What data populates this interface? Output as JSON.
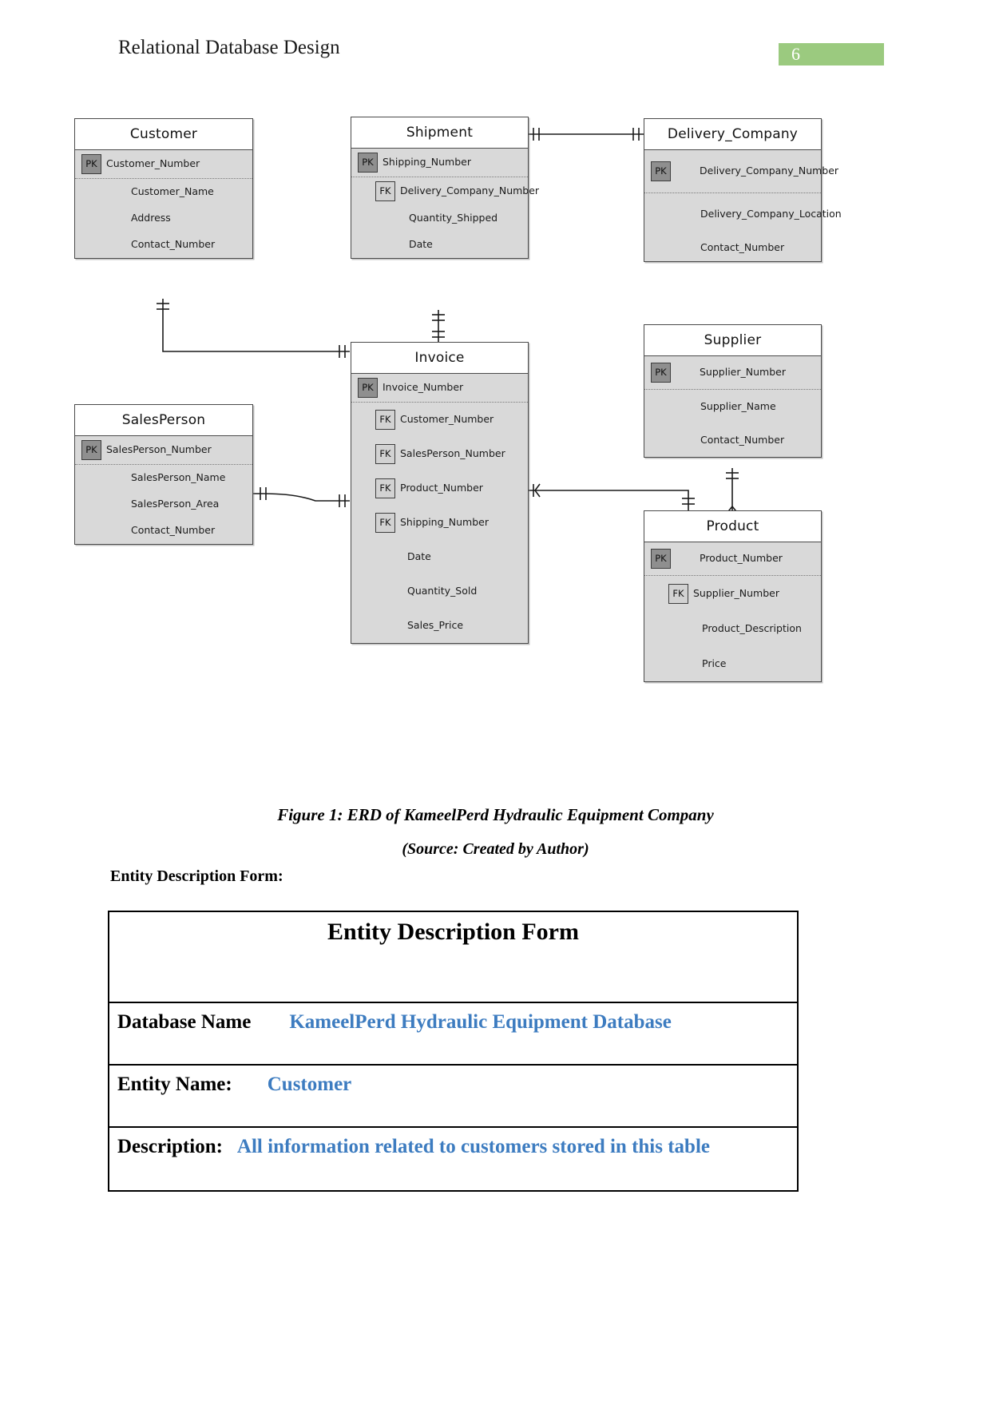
{
  "header": {
    "title": "Relational Database Design",
    "page_number": "6",
    "page_number_bg": "#9bca7f"
  },
  "erd": {
    "entities": [
      {
        "id": "customer",
        "name": "Customer",
        "attributes": [
          {
            "key": "PK",
            "label": "Customer_Number"
          },
          {
            "key": "",
            "label": "Customer_Name"
          },
          {
            "key": "",
            "label": "Address"
          },
          {
            "key": "",
            "label": "Contact_Number"
          }
        ]
      },
      {
        "id": "shipment",
        "name": "Shipment",
        "attributes": [
          {
            "key": "PK",
            "label": "Shipping_Number"
          },
          {
            "key": "FK",
            "label": "Delivery_Company_Number"
          },
          {
            "key": "",
            "label": "Quantity_Shipped"
          },
          {
            "key": "",
            "label": "Date"
          }
        ]
      },
      {
        "id": "delivery_company",
        "name": "Delivery_Company",
        "attributes": [
          {
            "key": "PK",
            "label": "Delivery_Company_Number"
          },
          {
            "key": "",
            "label": "Delivery_Company_Location"
          },
          {
            "key": "",
            "label": "Contact_Number"
          }
        ]
      },
      {
        "id": "salesperson",
        "name": "SalesPerson",
        "attributes": [
          {
            "key": "PK",
            "label": "SalesPerson_Number"
          },
          {
            "key": "",
            "label": "SalesPerson_Name"
          },
          {
            "key": "",
            "label": "SalesPerson_Area"
          },
          {
            "key": "",
            "label": "Contact_Number"
          }
        ]
      },
      {
        "id": "invoice",
        "name": "Invoice",
        "attributes": [
          {
            "key": "PK",
            "label": "Invoice_Number"
          },
          {
            "key": "FK",
            "label": "Customer_Number"
          },
          {
            "key": "FK",
            "label": "SalesPerson_Number"
          },
          {
            "key": "FK",
            "label": "Product_Number"
          },
          {
            "key": "FK",
            "label": "Shipping_Number"
          },
          {
            "key": "",
            "label": "Date"
          },
          {
            "key": "",
            "label": "Quantity_Sold"
          },
          {
            "key": "",
            "label": "Sales_Price"
          }
        ]
      },
      {
        "id": "supplier",
        "name": "Supplier",
        "attributes": [
          {
            "key": "PK",
            "label": "Supplier_Number"
          },
          {
            "key": "",
            "label": "Supplier_Name"
          },
          {
            "key": "",
            "label": "Contact_Number"
          }
        ]
      },
      {
        "id": "product",
        "name": "Product",
        "attributes": [
          {
            "key": "PK",
            "label": "Product_Number"
          },
          {
            "key": "FK",
            "label": "Supplier_Number"
          },
          {
            "key": "",
            "label": "Product_Description"
          },
          {
            "key": "",
            "label": "Price"
          }
        ]
      }
    ],
    "relationships": [
      {
        "from": "Shipment",
        "to": "Delivery_Company",
        "notation": "one-to-one"
      },
      {
        "from": "Customer",
        "to": "Invoice",
        "notation": "one-to-many"
      },
      {
        "from": "Shipment",
        "to": "Invoice",
        "notation": "one-to-one"
      },
      {
        "from": "SalesPerson",
        "to": "Invoice",
        "notation": "one-to-one"
      },
      {
        "from": "Invoice",
        "to": "Product",
        "notation": "one-to-many"
      },
      {
        "from": "Supplier",
        "to": "Product",
        "notation": "one-to-many"
      }
    ]
  },
  "figure": {
    "caption_line1": "Figure 1: ERD of KameelPerd Hydraulic Equipment Company",
    "caption_line2": "(Source: Created by Author)"
  },
  "section": {
    "label": "Entity Description Form:"
  },
  "form": {
    "title": "Entity Description Form",
    "rows": [
      {
        "label": "Database Name",
        "value": "KameelPerd Hydraulic Equipment Database"
      },
      {
        "label": "Entity Name:",
        "value": "Customer"
      },
      {
        "label": "Description:",
        "value": "All information related to customers stored in this table"
      }
    ],
    "value_color": "#3d7cc0"
  }
}
